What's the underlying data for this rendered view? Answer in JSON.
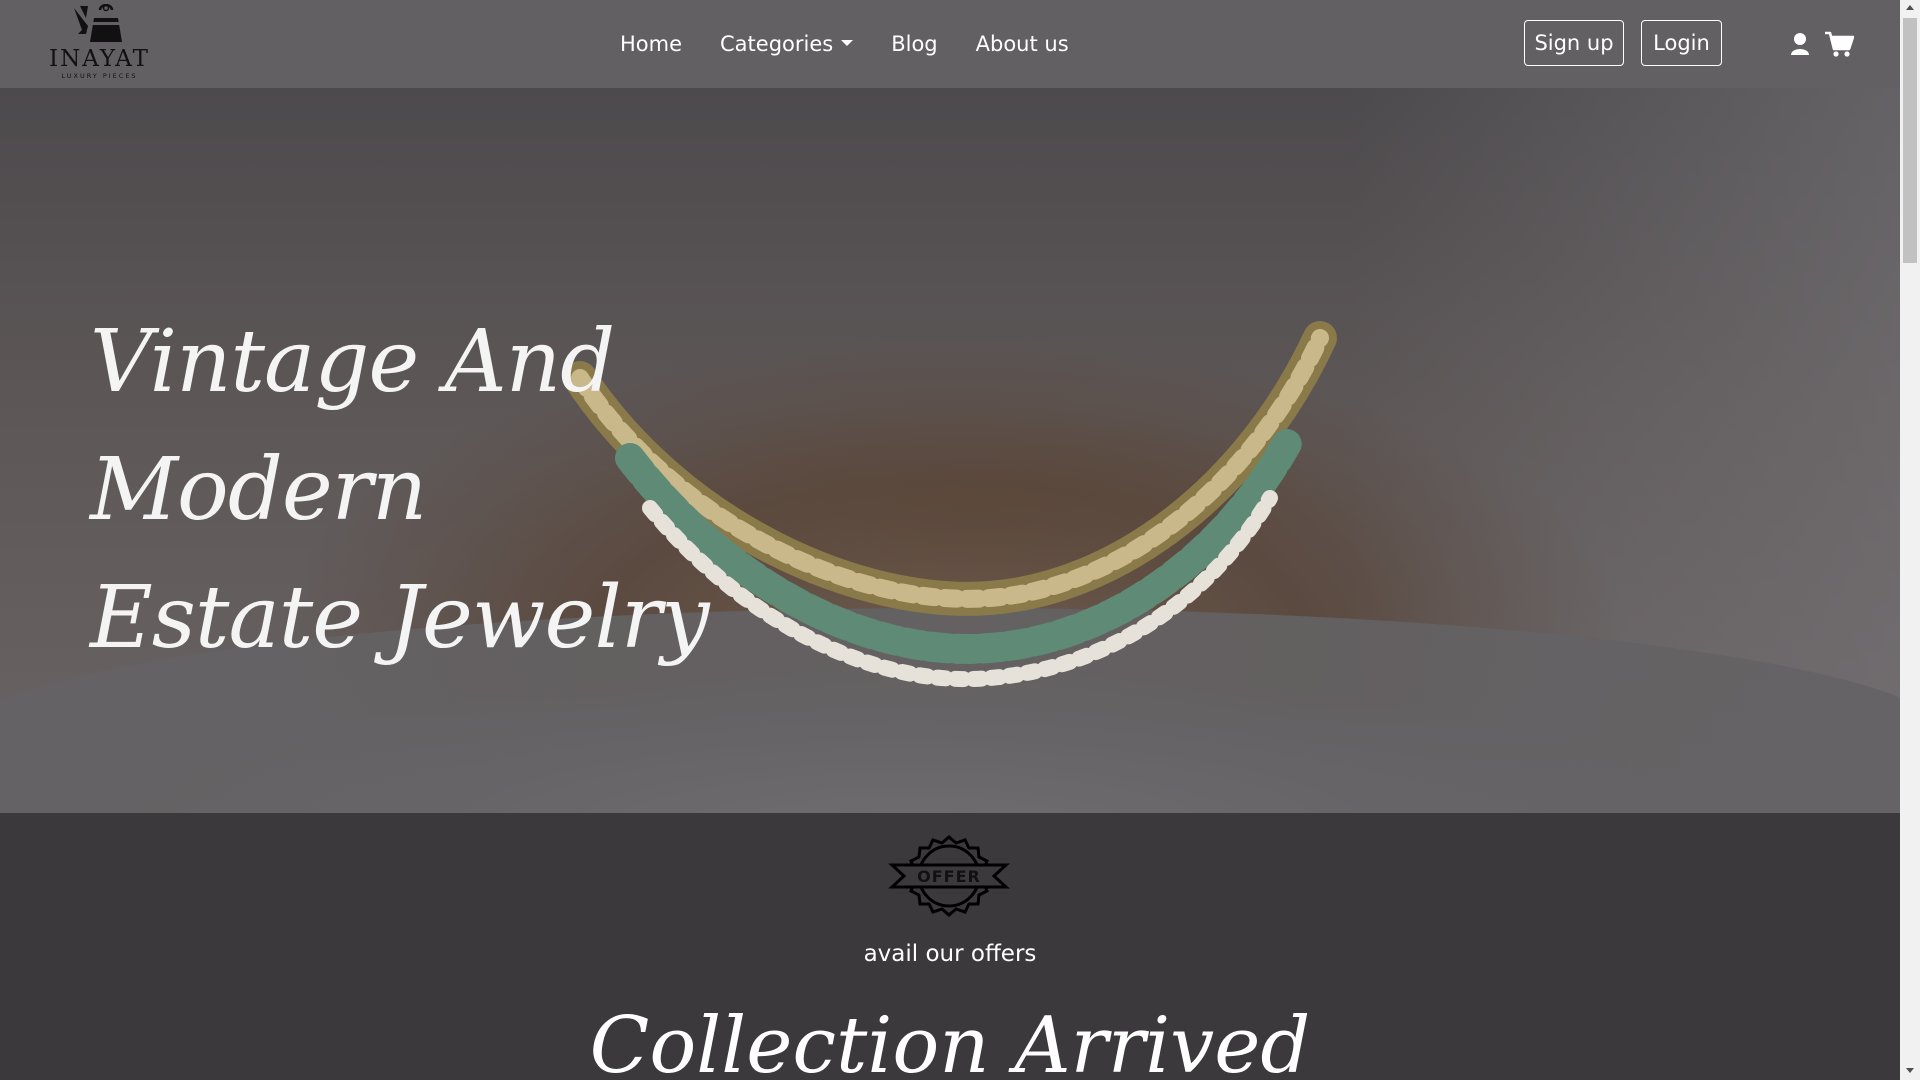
{
  "brand": {
    "name": "INAYAT",
    "tagline": "LUXURY PIECES"
  },
  "nav": {
    "items": [
      {
        "label": "Home"
      },
      {
        "label": "Categories"
      },
      {
        "label": "Blog"
      },
      {
        "label": "About us"
      }
    ],
    "signup_label": "Sign up",
    "login_label": "Login",
    "icons": [
      "user-icon",
      "cart-icon"
    ]
  },
  "hero": {
    "title_lines": [
      "Vintage And",
      "Modern",
      "Estate Jewelry"
    ]
  },
  "offer": {
    "badge_text": "OFFER",
    "caption": "avail our offers"
  },
  "collection": {
    "title": "Collection Arrived"
  },
  "colors": {
    "navbar_bg": "#626062",
    "page_bg": "#3b393c",
    "text": "#ffffff"
  }
}
